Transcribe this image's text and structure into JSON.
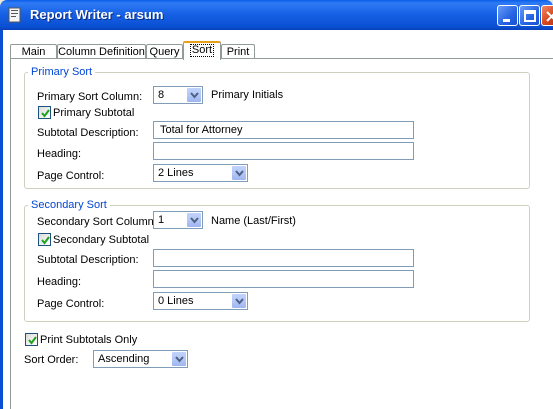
{
  "window": {
    "title": "Report Writer - arsum"
  },
  "tabs": [
    {
      "label": "Main"
    },
    {
      "label": "Column Definition"
    },
    {
      "label": "Query"
    },
    {
      "label": "Sort"
    },
    {
      "label": "Print"
    }
  ],
  "primary_sort": {
    "group_title": "Primary Sort",
    "column_label": "Primary Sort Column:",
    "column_value": "8",
    "column_name": "Primary Initials",
    "subtotal_label": "Primary Subtotal",
    "subtotal_checked": true,
    "subtotal_description_label": "Subtotal Description:",
    "subtotal_description_value": "Total for Attorney",
    "heading_label": "Heading:",
    "heading_value": "",
    "page_control_label": "Page Control:",
    "page_control_value": "2 Lines"
  },
  "secondary_sort": {
    "group_title": "Secondary Sort",
    "column_label": "Secondary Sort Column:",
    "column_value": "1",
    "column_name": "Name (Last/First)",
    "subtotal_label": "Secondary Subtotal",
    "subtotal_checked": true,
    "subtotal_description_label": "Subtotal Description:",
    "subtotal_description_value": "",
    "heading_label": "Heading:",
    "heading_value": "",
    "page_control_label": "Page Control:",
    "page_control_value": "0 Lines"
  },
  "options": {
    "print_subtotals_only_label": "Print Subtotals Only",
    "print_subtotals_only_checked": true,
    "sort_order_label": "Sort Order:",
    "sort_order_value": "Ascending"
  }
}
